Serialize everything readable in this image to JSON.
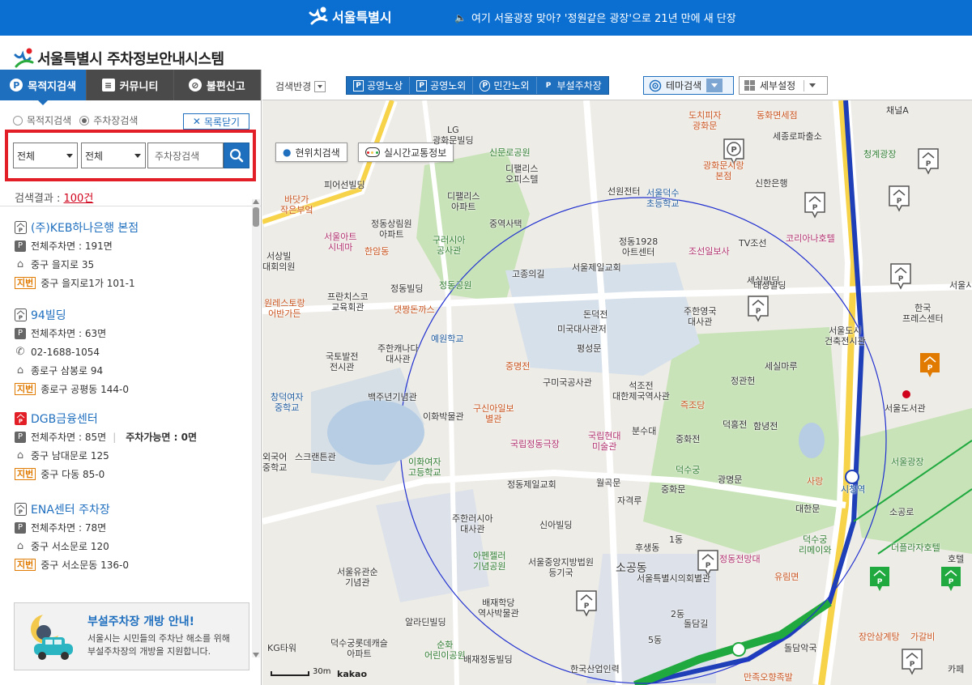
{
  "topbar": {
    "logo_text": "서울특별시",
    "notice": "여기 서울광장 맞아? '정원같은 광장'으로 21년 만에 새 단장"
  },
  "header": {
    "title": "서울특별시 주차정보안내시스템"
  },
  "tabs": [
    {
      "label": "목적지검색",
      "icon": "parking-circle-icon",
      "active": true
    },
    {
      "label": "커뮤니티",
      "icon": "chat-icon",
      "active": false
    },
    {
      "label": "불편신고",
      "icon": "ban-icon",
      "active": false
    }
  ],
  "search": {
    "radio_destination": "목적지검색",
    "radio_parking": "주차장검색",
    "close_list": "목록닫기",
    "select1": "전체",
    "select2": "전체",
    "keyword_placeholder": "주차장검색"
  },
  "results": {
    "label": "검색결과 :",
    "count": "100건",
    "items": [
      {
        "name": "(주)KEB하나은행 본점",
        "type": "private",
        "spaces": "전체주차면 : 191면",
        "road": "중구 을지로 35",
        "jibun_tag": "지번",
        "jibun": "중구 을지로1가 101-1"
      },
      {
        "name": "94빌딩",
        "type": "private",
        "spaces": "전체주차면 : 63면",
        "phone": "02-1688-1054",
        "road": "종로구 삼봉로 94",
        "jibun_tag": "지번",
        "jibun": "종로구 공평동 144-0"
      },
      {
        "name": "DGB금융센터",
        "type": "public",
        "spaces": "전체주차면 : 85면",
        "available": "주차가능면 : 0면",
        "road": "중구 남대문로 125",
        "jibun_tag": "지번",
        "jibun": "중구 다동 85-0"
      },
      {
        "name": "ENA센터 주차장",
        "type": "private",
        "spaces": "전체주차면 : 78면",
        "road": "중구 서소문로 120",
        "jibun_tag": "지번",
        "jibun": "중구 서소문동 136-0"
      }
    ]
  },
  "banner": {
    "title": "부설주차장 개방 안내!",
    "line1": "서울시는 시민들의 주차난 해소를 위해",
    "line2": "부설주차장의 개방을 지원합니다."
  },
  "toolbar": {
    "search_reflect": "검색반경",
    "layers": [
      {
        "label": "공영노상",
        "icon": "P"
      },
      {
        "label": "공영노외",
        "icon": "P"
      },
      {
        "label": "민간노외",
        "icon": "P"
      },
      {
        "label": "부설주차장",
        "icon": "P"
      }
    ],
    "theme": "테마검색",
    "detail": "세부설정"
  },
  "map": {
    "current_location": "현위치검색",
    "realtime_traffic": "실시간교통정보",
    "scale": "30m",
    "provider": "kakao",
    "labels": [
      {
        "t": "LG\n광화문빌딩"
      },
      {
        "t": "신문로공원"
      },
      {
        "t": "디팰리스\n오피스텔"
      },
      {
        "t": "디팰리스\n아파트"
      },
      {
        "t": "피어선빌딩"
      },
      {
        "t": "정동상림원\n아파트"
      },
      {
        "t": "중역사택"
      },
      {
        "t": "구러시아\n공사관"
      },
      {
        "t": "서울아트\n시네마"
      },
      {
        "t": "한암동"
      },
      {
        "t": "정동공원"
      },
      {
        "t": "고종의길"
      },
      {
        "t": "정동빌딩"
      },
      {
        "t": "프란치스코\n교육회관"
      },
      {
        "t": "댓짱돈까스"
      },
      {
        "t": "예원학교"
      },
      {
        "t": "국토발전\n전시관"
      },
      {
        "t": "주한캐나다\n대사관"
      },
      {
        "t": "중명전"
      },
      {
        "t": "미국대사관저"
      },
      {
        "t": "구미국공사관"
      },
      {
        "t": "백주년기념관"
      },
      {
        "t": "이화박물관"
      },
      {
        "t": "구신아일보\n별관"
      },
      {
        "t": "이화여자\n고등학교"
      },
      {
        "t": "국립정동극장"
      },
      {
        "t": "정동제일교회"
      },
      {
        "t": "주한러시아\n대사관"
      },
      {
        "t": "신아빌딩"
      },
      {
        "t": "아펜젤러\n기념공원"
      },
      {
        "t": "서울중앙지방법원\n등기국"
      },
      {
        "t": "서울유관순\n기념관"
      },
      {
        "t": "배재학당\n역사박물관"
      },
      {
        "t": "알라딘빌딩"
      },
      {
        "t": "덕수궁롯데캐슬\n아파트"
      },
      {
        "t": "순화\n어린이공원"
      },
      {
        "t": "배재정동빌딩"
      },
      {
        "t": "한국산업인력"
      },
      {
        "t": "서울덕수\n초등학교"
      },
      {
        "t": "정동1928\n아트센터"
      },
      {
        "t": "세실빌딩"
      },
      {
        "t": "주한영국\n대사관"
      },
      {
        "t": "돈덕전"
      },
      {
        "t": "평성문"
      },
      {
        "t": "석조전\n대한제국역사관"
      },
      {
        "t": "국립현대\n미술관"
      },
      {
        "t": "분수대"
      },
      {
        "t": "중화전"
      },
      {
        "t": "덕수궁"
      },
      {
        "t": "즉조당"
      },
      {
        "t": "덕홍전"
      },
      {
        "t": "함녕전"
      },
      {
        "t": "정관헌"
      },
      {
        "t": "세실마루"
      },
      {
        "t": "광명문"
      },
      {
        "t": "대한문"
      },
      {
        "t": "서울도서관"
      },
      {
        "t": "서울광장"
      },
      {
        "t": "시청역"
      },
      {
        "t": "서울특별시의회별관"
      },
      {
        "t": "소공동"
      },
      {
        "t": "조선일보사"
      },
      {
        "t": "태성빌딩"
      },
      {
        "t": "서울도시\n건축전시관"
      },
      {
        "t": "한국\n프레스센터"
      },
      {
        "t": "세종로파출소"
      },
      {
        "t": "신한은행"
      },
      {
        "t": "채널A"
      },
      {
        "t": "청계광장"
      },
      {
        "t": "코리아나호텔"
      },
      {
        "t": "TV조선"
      },
      {
        "t": "덕수궁\n리메이와"
      },
      {
        "t": "더플라자호텔"
      },
      {
        "t": "장안삼계탕"
      },
      {
        "t": "만족오향족발"
      },
      {
        "t": "KG타워"
      },
      {
        "t": "선원전터"
      },
      {
        "t": "동화면세점"
      },
      {
        "t": "도치피자\n광화문"
      },
      {
        "t": "광화문시랑\n본점"
      },
      {
        "t": "서울제일교회"
      },
      {
        "t": "창덕여자\n중학교"
      },
      {
        "t": "원레스토랑\n어반가든"
      },
      {
        "t": "바닷가\n작은부엌"
      },
      {
        "t": "서상빌\n대회의원"
      },
      {
        "t": "스크랜튼관"
      },
      {
        "t": "외국어\n중학교"
      },
      {
        "t": "후생동"
      },
      {
        "t": "1동"
      },
      {
        "t": "2동"
      },
      {
        "t": "5동"
      },
      {
        "t": "자격루"
      },
      {
        "t": "월곡문"
      },
      {
        "t": "중화문"
      },
      {
        "t": "정동전망대"
      },
      {
        "t": "유림면"
      },
      {
        "t": "사랑"
      },
      {
        "t": "소공로"
      },
      {
        "t": "돌담악국"
      },
      {
        "t": "가갈비"
      },
      {
        "t": "카페"
      },
      {
        "t": "호텔"
      },
      {
        "t": "서울시민대"
      },
      {
        "t": "돌담길"
      }
    ]
  }
}
